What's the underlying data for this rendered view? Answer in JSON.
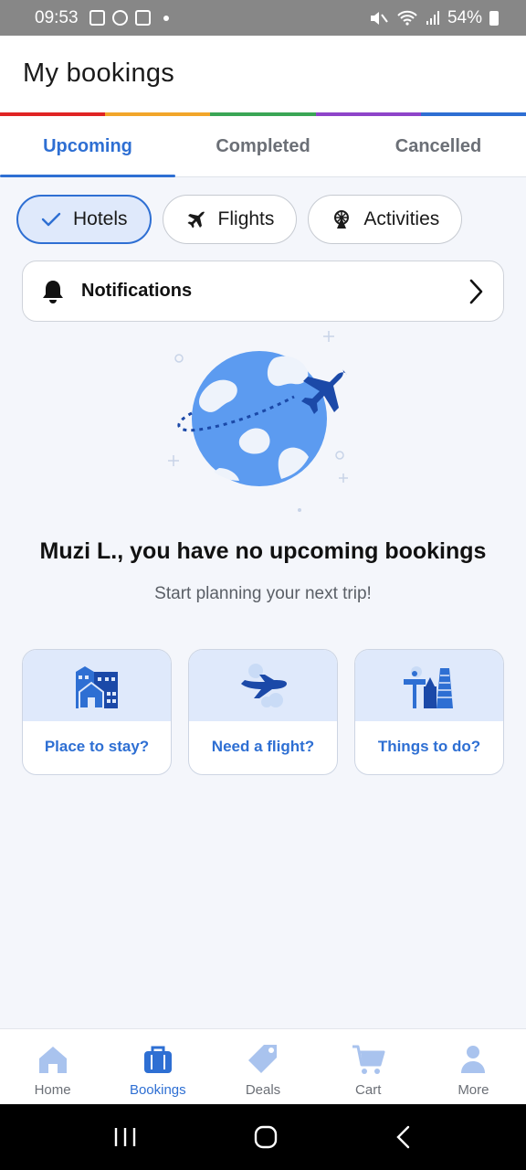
{
  "status_bar": {
    "time": "09:53",
    "battery": "54%"
  },
  "header": {
    "title": "My bookings"
  },
  "rainbow_colors": [
    "#e02424",
    "#f2a62a",
    "#3aa655",
    "#8e44c9",
    "#2e6fd3"
  ],
  "tabs": [
    {
      "label": "Upcoming",
      "active": true
    },
    {
      "label": "Completed",
      "active": false
    },
    {
      "label": "Cancelled",
      "active": false
    }
  ],
  "filters": [
    {
      "label": "Hotels",
      "icon": "check-icon",
      "selected": true
    },
    {
      "label": "Flights",
      "icon": "plane-icon",
      "selected": false
    },
    {
      "label": "Activities",
      "icon": "ferris-wheel-icon",
      "selected": false
    }
  ],
  "notifications": {
    "label": "Notifications"
  },
  "empty_state": {
    "title": "Muzi L., you have no upcoming bookings",
    "subtitle": "Start planning your next trip!"
  },
  "cards": [
    {
      "label": "Place to stay?",
      "icon": "hotel-building-icon"
    },
    {
      "label": "Need a flight?",
      "icon": "airplane-icon"
    },
    {
      "label": "Things to do?",
      "icon": "landmarks-icon"
    }
  ],
  "bottom_nav": [
    {
      "label": "Home",
      "icon": "home-icon",
      "active": false
    },
    {
      "label": "Bookings",
      "icon": "briefcase-icon",
      "active": true
    },
    {
      "label": "Deals",
      "icon": "tag-icon",
      "active": false
    },
    {
      "label": "Cart",
      "icon": "cart-icon",
      "active": false
    },
    {
      "label": "More",
      "icon": "person-icon",
      "active": false
    }
  ],
  "colors": {
    "accent": "#2e6fd3",
    "accent_light": "#dfe9fb",
    "icon_light": "#a9c3ee"
  }
}
